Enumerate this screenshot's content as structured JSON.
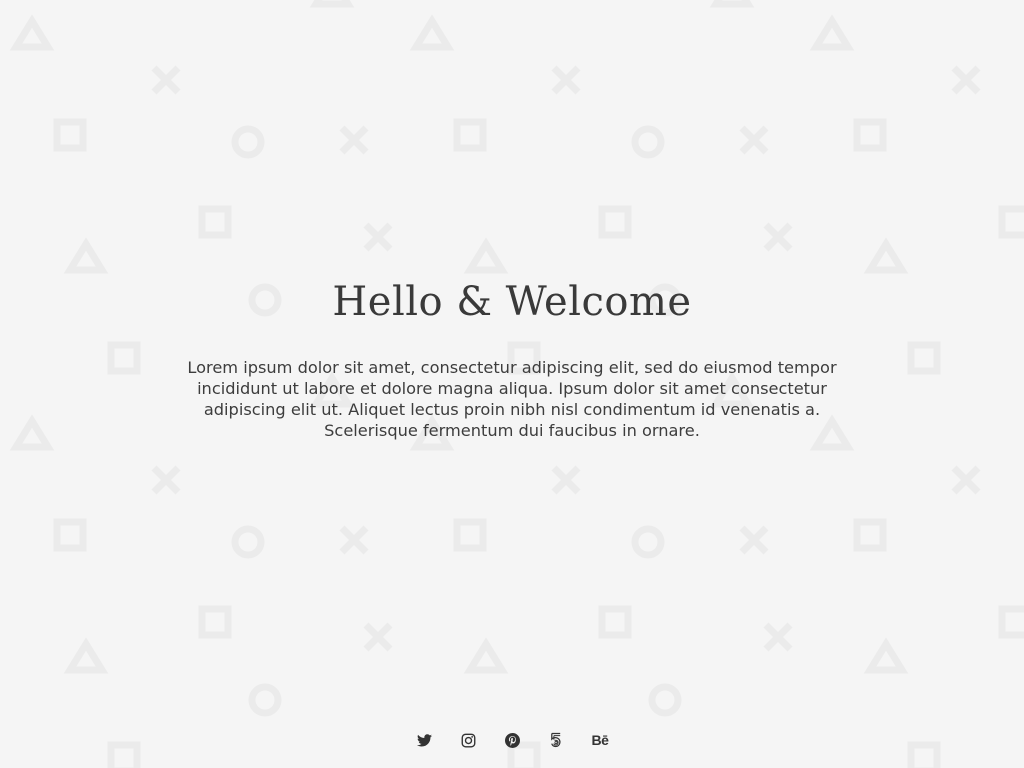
{
  "page": {
    "title": "Hello & Welcome",
    "intro": "Lorem ipsum dolor sit amet, consectetur adipiscing elit, sed do eiusmod tempor incididunt ut labore et dolore magna aliqua. Ipsum dolor sit amet consectetur adipiscing elit ut. Aliquet lectus proin nibh nisl condimentum id venenatis a. Scelerisque fermentum dui faucibus in ornare."
  },
  "social": {
    "items": [
      {
        "icon": "twitter-icon"
      },
      {
        "icon": "instagram-icon"
      },
      {
        "icon": "pinterest-icon"
      },
      {
        "icon": "500px-icon"
      },
      {
        "icon": "behance-icon",
        "label": "Bē"
      }
    ]
  },
  "colors": {
    "background": "#f5f5f5",
    "pattern": "#ebebeb",
    "text": "#333333"
  }
}
